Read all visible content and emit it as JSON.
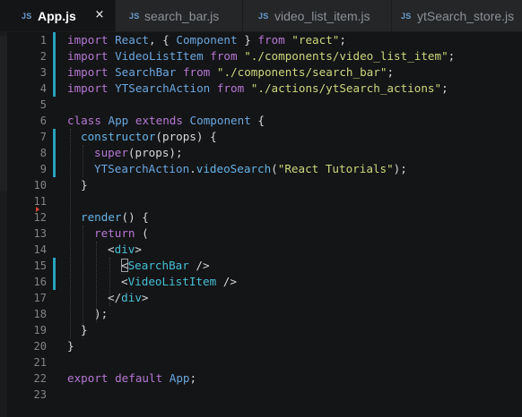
{
  "tabs": [
    {
      "badge": "JS",
      "label": "App.js",
      "active": true
    },
    {
      "badge": "JS",
      "label": "search_bar.js",
      "active": false
    },
    {
      "badge": "JS",
      "label": "video_list_item.js",
      "active": false
    },
    {
      "badge": "JS",
      "label": "ytSearch_store.js",
      "active": false
    }
  ],
  "close_glyph": "×",
  "line_numbers": [
    "1",
    "2",
    "3",
    "4",
    "5",
    "6",
    "7",
    "8",
    "9",
    "10",
    "11",
    "12",
    "13",
    "14",
    "15",
    "16",
    "17",
    "18",
    "19",
    "20",
    "21",
    "22",
    "23"
  ],
  "code": {
    "l1": {
      "kw_import": "import",
      "name": "React",
      "p1": ", { ",
      "comp": "Component",
      "p2": " } ",
      "kw_from": "from",
      "str": "\"react\"",
      "semi": ";"
    },
    "l2": {
      "kw_import": "import",
      "name": "VideoListItem",
      "kw_from": "from",
      "str": "\"./components/video_list_item\"",
      "semi": ";"
    },
    "l3": {
      "kw_import": "import",
      "name": "SearchBar",
      "kw_from": "from",
      "str": "\"./components/search_bar\"",
      "semi": ";"
    },
    "l4": {
      "kw_import": "import",
      "name": "YTSearchAction",
      "kw_from": "from",
      "str": "\"./actions/ytSearch_actions\"",
      "semi": ";"
    },
    "l6": {
      "kw_class": "class",
      "name": "App",
      "kw_extends": "extends",
      "comp": "Component",
      "brace": " {"
    },
    "l7": {
      "fn": "constructor",
      "params": "(props) {"
    },
    "l8": {
      "fn": "super",
      "params": "(props);"
    },
    "l9": {
      "name": "YTSearchAction",
      "dot": ".",
      "fn": "videoSearch",
      "p1": "(",
      "str": "\"React Tutorials\"",
      "p2": ");"
    },
    "l10": {
      "text": "}"
    },
    "l12": {
      "fn": "render",
      "params": "() {"
    },
    "l13": {
      "kw": "return",
      "p": " ("
    },
    "l14": {
      "lt": "<",
      "tag": "div",
      "gt": ">"
    },
    "l15": {
      "lt": "<",
      "tag": "SearchBar",
      "end": " />"
    },
    "l16": {
      "lt": "<",
      "tag": "VideoListItem",
      "end": " />"
    },
    "l17": {
      "lt": "</",
      "tag": "div",
      "gt": ">"
    },
    "l18": {
      "text": ");"
    },
    "l19": {
      "text": "}"
    },
    "l20": {
      "text": "}"
    },
    "l22": {
      "kw_export": "export",
      "kw_default": "default",
      "name": "App",
      "semi": ";"
    }
  },
  "colors": {
    "keyword": "#b678d4",
    "class_name": "#6aa7e0",
    "string": "#cdd77a",
    "function": "#64b4e6",
    "jsx_tag": "#46bfd4",
    "git_modified": "#27a3bc",
    "breakpoint": "#e0452f"
  }
}
